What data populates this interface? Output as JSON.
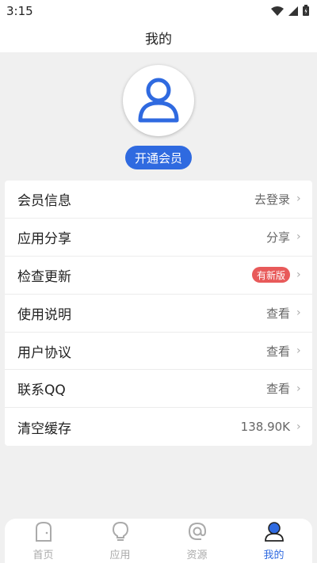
{
  "status_bar": {
    "time": "3:15"
  },
  "header": {
    "title": "我的"
  },
  "profile": {
    "vip_button_label": "开通会员"
  },
  "menu": {
    "items": [
      {
        "label": "会员信息",
        "value": "去登录"
      },
      {
        "label": "应用分享",
        "value": "分享"
      },
      {
        "label": "检查更新",
        "badge": "有新版"
      },
      {
        "label": "使用说明",
        "value": "查看"
      },
      {
        "label": "用户协议",
        "value": "查看"
      },
      {
        "label": "联系QQ",
        "value": "查看"
      },
      {
        "label": "清空缓存",
        "value": "138.90K"
      }
    ]
  },
  "tabs": [
    {
      "label": "首页",
      "icon": "home-icon",
      "active": false
    },
    {
      "label": "应用",
      "icon": "lightbulb-icon",
      "active": false
    },
    {
      "label": "资源",
      "icon": "at-icon",
      "active": false
    },
    {
      "label": "我的",
      "icon": "profile-icon",
      "active": true
    }
  ],
  "colors": {
    "accent": "#2f6ae0",
    "badge": "#e85a5a",
    "background": "#f0f0f0"
  }
}
